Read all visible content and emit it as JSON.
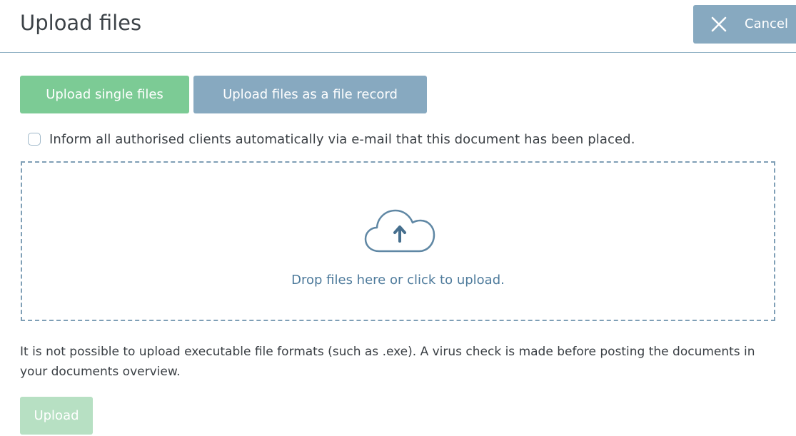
{
  "header": {
    "title": "Upload files",
    "cancel_label": "Cancel",
    "cancel_icon": "close-icon"
  },
  "tabs": {
    "single_label": "Upload single files",
    "record_label": "Upload files as a file record"
  },
  "notify": {
    "checked": false,
    "label": "Inform all authorised clients automatically via e-mail that this document has been placed."
  },
  "dropzone": {
    "icon": "cloud-upload-icon",
    "text": "Drop files here or click to upload."
  },
  "info_text": "It is not possible to upload executable file formats (such as .exe). A virus check is made before posting the documents in your documents overview.",
  "upload_button": {
    "label": "Upload",
    "disabled": true
  },
  "colors": {
    "primary_green": "#7ccb95",
    "secondary_blue": "#87a9c0",
    "disabled_green": "#b7e0c3",
    "link_blue": "#4d7a9b"
  }
}
